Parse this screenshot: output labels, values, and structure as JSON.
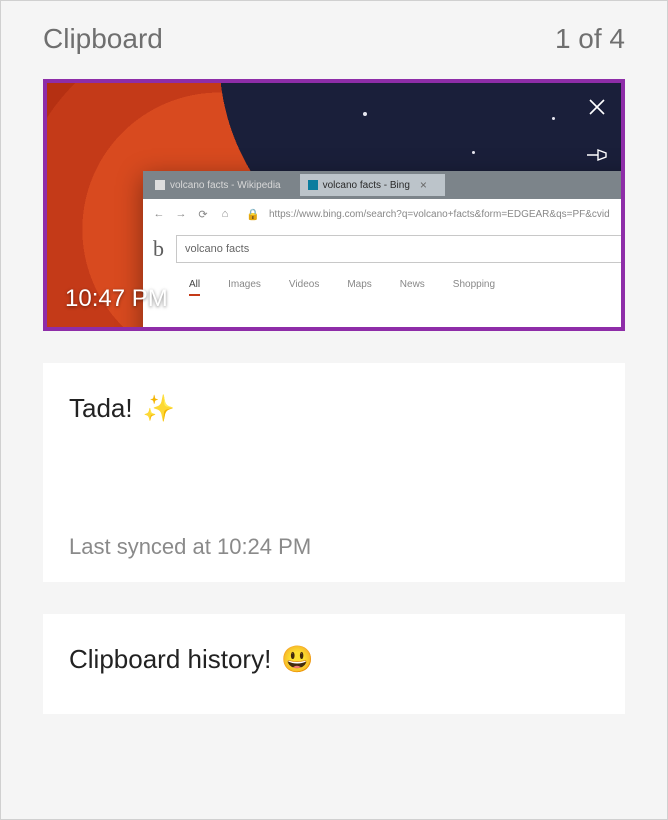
{
  "header": {
    "title": "Clipboard",
    "counter": "1 of 4"
  },
  "items": [
    {
      "type": "image",
      "timestamp": "10:47 PM",
      "thumb": {
        "tab1_label": "volcano facts - Wikipedia",
        "tab2_label": "volcano facts - Bing",
        "address_url": "https://www.bing.com/search?q=volcano+facts&form=EDGEAR&qs=PF&cvid",
        "search_query": "volcano facts",
        "nav": [
          "All",
          "Images",
          "Videos",
          "Maps",
          "News",
          "Shopping"
        ]
      }
    },
    {
      "type": "text",
      "text": "Tada!",
      "emoji": "✨",
      "sync_text": "Last synced at 10:24 PM"
    },
    {
      "type": "text",
      "text": "Clipboard history!",
      "emoji": "😃"
    }
  ],
  "icons": {
    "close": "close-icon",
    "pin": "pin-icon"
  }
}
